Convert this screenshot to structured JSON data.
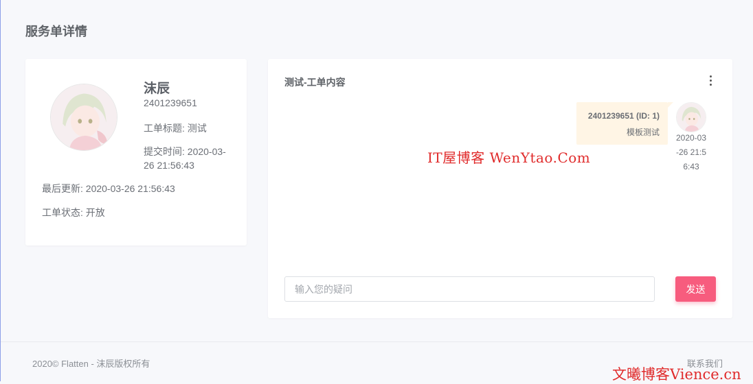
{
  "page": {
    "title": "服务单详情"
  },
  "profile": {
    "name": "沫辰",
    "id": "2401239651",
    "ticket_title": "工单标题: 测试",
    "submit_time": "提交时间: 2020-03-26 21:56:43",
    "last_updated": "最后更新: 2020-03-26 21:56:43",
    "status": "工单状态: 开放",
    "avatar_icon": "anime-avatar-icon"
  },
  "chat": {
    "title": "测试-工单内容",
    "more_icon": "more-vertical-icon",
    "messages": [
      {
        "sender": "2401239651 (ID: 1)",
        "text": "模板测试",
        "time": "2020-03-26 21:56:43"
      }
    ],
    "input_placeholder": "输入您的疑问",
    "send_label": "发送",
    "accent_color": "#f75c7e",
    "bubble_color": "#fff5e5"
  },
  "watermarks": {
    "center": "IT屋博客 WenYtao.Com",
    "bottom": "文曦博客Vience.cn"
  },
  "footer": {
    "copyright": "2020© Flatten - 沫辰版权所有",
    "contact": "联系我们"
  }
}
